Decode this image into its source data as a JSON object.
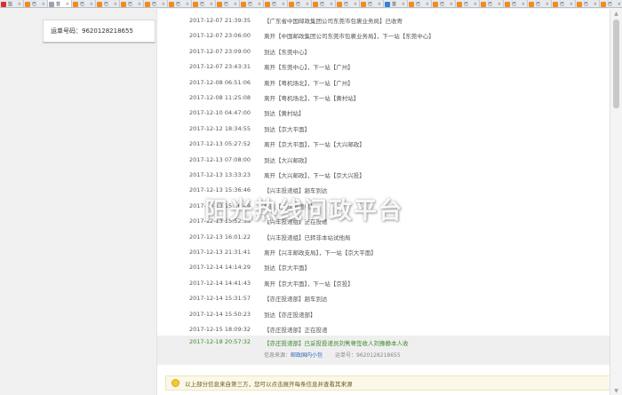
{
  "tabs": [
    {
      "label": "监",
      "icon": "red",
      "active": false
    },
    {
      "label": "已",
      "icon": "orange",
      "active": false
    },
    {
      "label": "首",
      "icon": "gray",
      "active": true
    },
    {
      "label": "已",
      "icon": "orange",
      "active": false
    },
    {
      "label": "已",
      "icon": "orange",
      "active": false
    },
    {
      "label": "已",
      "icon": "orange",
      "active": false
    },
    {
      "label": "已",
      "icon": "orange",
      "active": false
    },
    {
      "label": "已",
      "icon": "orange",
      "active": false
    },
    {
      "label": "已",
      "icon": "orange",
      "active": false
    },
    {
      "label": "已",
      "icon": "orange",
      "active": false
    },
    {
      "label": "已",
      "icon": "orange",
      "active": false
    },
    {
      "label": "已",
      "icon": "orange",
      "active": false
    },
    {
      "label": "已",
      "icon": "orange",
      "active": false
    },
    {
      "label": "已",
      "icon": "orange",
      "active": false
    },
    {
      "label": "已",
      "icon": "orange",
      "active": false
    },
    {
      "label": "已",
      "icon": "orange",
      "active": false
    },
    {
      "label": "首",
      "icon": "blue",
      "active": false
    },
    {
      "label": "已",
      "icon": "orange",
      "active": false
    },
    {
      "label": "已",
      "icon": "orange",
      "active": false
    },
    {
      "label": "已",
      "icon": "orange",
      "active": false
    },
    {
      "label": "已",
      "icon": "orange",
      "active": false
    },
    {
      "label": "已",
      "icon": "orange",
      "active": false
    },
    {
      "label": "已",
      "icon": "orange",
      "active": false
    },
    {
      "label": "已",
      "icon": "orange",
      "active": false
    },
    {
      "label": "已",
      "icon": "orange",
      "active": false
    },
    {
      "label": "已",
      "icon": "orange",
      "active": false
    }
  ],
  "waybill": {
    "label": "运单号码：9620128218655"
  },
  "tracking": [
    {
      "time": "2017-12-07 21:39:35",
      "desc": "【广东省中国邮政集团公司东莞市包裹业务局】已收寄"
    },
    {
      "time": "2017-12-07 23:06:00",
      "desc": "离开【中国邮政集团公司东莞市包裹业务局】，下一站【东莞中心】"
    },
    {
      "time": "2017-12-07 23:09:00",
      "desc": "到达【东莞中心】"
    },
    {
      "time": "2017-12-07 23:43:31",
      "desc": "离开【东莞中心】，下一站【广州】"
    },
    {
      "time": "2017-12-08 06:51:06",
      "desc": "离开【粤机场北】，下一站【广州】"
    },
    {
      "time": "2017-12-08 11:25:08",
      "desc": "离开【粤机场北】，下一站【黄村站】"
    },
    {
      "time": "2017-12-10 04:47:00",
      "desc": "到达【黄村站】"
    },
    {
      "time": "2017-12-12 18:34:55",
      "desc": "到达【京大平面】"
    },
    {
      "time": "2017-12-13 05:27:52",
      "desc": "离开【京大平面】，下一站【大兴邮政】"
    },
    {
      "time": "2017-12-13 07:08:00",
      "desc": "到达【大兴邮政】"
    },
    {
      "time": "2017-12-13 13:33:23",
      "desc": "离开【大兴邮政】，下一站【京大兴投】"
    },
    {
      "time": "2017-12-13 15:36:46",
      "desc": "【兴丰投递组】趟车到达"
    },
    {
      "time": "2017-12-13 15:36:49",
      "desc": "到达【兴丰投递组】"
    },
    {
      "time": "2017-12-13 15:52:53",
      "desc": "【兴丰投递组】正在投递"
    },
    {
      "time": "2017-12-13 16:01:22",
      "desc": "【兴丰投递组】已转非本站试他局"
    },
    {
      "time": "2017-12-13 21:31:41",
      "desc": "离开【兴丰邮政支局】，下一站【京大平面】"
    },
    {
      "time": "2017-12-14 14:14:29",
      "desc": "到达【京大平面】"
    },
    {
      "time": "2017-12-14 14:41:43",
      "desc": "离开【京大平面】，下一站【京投】"
    },
    {
      "time": "2017-12-14 15:31:57",
      "desc": "【亦庄投递部】趟车到达"
    },
    {
      "time": "2017-12-14 15:50:23",
      "desc": "到达【亦庄投递部】"
    },
    {
      "time": "2017-12-15 18:09:32",
      "desc": "【亦庄投递部】正在投递"
    }
  ],
  "latest": {
    "time": "2017-12-18 20:57:32",
    "desc": "【亦庄投递部】已妥投投递员刘隽萼签收人刘豫静本人收",
    "source_label": "信息来源：",
    "source_link": "邮政国内小包",
    "waybill": "运单号：9620128218655"
  },
  "watermark": "阳光热线问政平台",
  "notice": {
    "text": "以上部分信息来自第三方，您可以点击展开每条信息并查看其来源"
  },
  "colors": {
    "latest_green": "#3d8a2b",
    "link_blue": "#2b63b5"
  }
}
